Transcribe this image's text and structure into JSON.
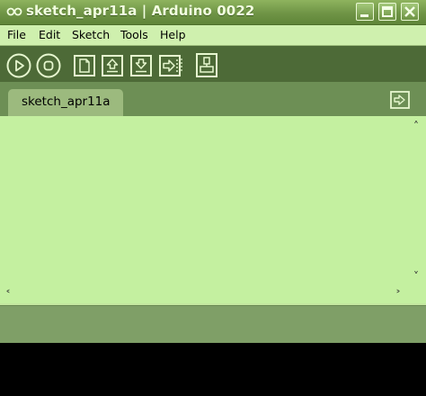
{
  "window": {
    "title": "sketch_apr11a | Arduino 0022",
    "controls": [
      "minimize-icon",
      "maximize-icon",
      "close-icon"
    ]
  },
  "menu": {
    "items": [
      "File",
      "Edit",
      "Sketch",
      "Tools",
      "Help"
    ]
  },
  "toolbar": {
    "buttons": [
      "run-icon",
      "stop-icon",
      "new-icon",
      "open-icon",
      "save-icon",
      "upload-icon",
      "serial-monitor-icon"
    ]
  },
  "tabs": [
    {
      "label": "sketch_apr11a"
    }
  ],
  "editor": {
    "content": ""
  },
  "colors": {
    "titlebar": "#6f9446",
    "menubar": "#cff0ae",
    "toolbar": "#4d6a37",
    "tabstrip": "#6d8f55",
    "tab": "#9cba7e",
    "editor": "#c4f0a0",
    "status": "#7f9f67",
    "console": "#000000"
  }
}
